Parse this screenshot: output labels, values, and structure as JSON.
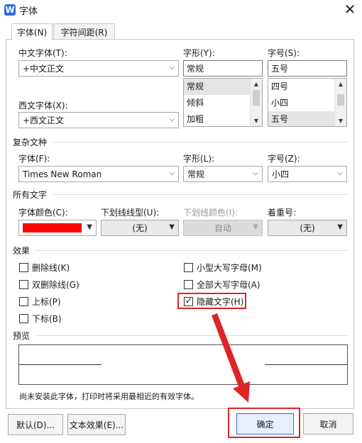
{
  "window": {
    "title": "字体",
    "app_icon": "W"
  },
  "tabs": [
    {
      "label": "字体(N)"
    },
    {
      "label": "字符间距(R)"
    }
  ],
  "chinese_font": {
    "label": "中文字体(T):",
    "value": "+中文正文"
  },
  "western_font": {
    "label": "西文字体(X):",
    "value": "+西文正文"
  },
  "style": {
    "label": "字形(Y):",
    "value": "常规",
    "options": [
      "常规",
      "倾斜",
      "加粗"
    ]
  },
  "size": {
    "label": "字号(S):",
    "value": "五号",
    "options": [
      "四号",
      "小四",
      "五号"
    ]
  },
  "complex": {
    "section": "复杂文种",
    "font_label": "字体(F):",
    "font_value": "Times New Roman",
    "style_label": "字形(L):",
    "style_value": "常规",
    "size_label": "字号(Z):",
    "size_value": "小四"
  },
  "all_text": {
    "section": "所有文字",
    "color_label": "字体颜色(C):",
    "color_value": "#ff0000",
    "underline_label": "下划线线型(U):",
    "underline_value": "(无)",
    "underline_color_label": "下划线颜色(I):",
    "underline_color_value": "自动",
    "emphasis_label": "着重号:",
    "emphasis_value": "(无)"
  },
  "effects": {
    "section": "效果",
    "items": [
      {
        "label": "删除线(K)",
        "checked": false
      },
      {
        "label": "双删除线(G)",
        "checked": false
      },
      {
        "label": "上标(P)",
        "checked": false
      },
      {
        "label": "下标(B)",
        "checked": false
      },
      {
        "label": "小型大写字母(M)",
        "checked": false
      },
      {
        "label": "全部大写字母(A)",
        "checked": false
      },
      {
        "label": "隐藏文字(H)",
        "checked": true
      }
    ]
  },
  "preview": {
    "section": "预览",
    "note": "尚未安装此字体，打印时将采用最相近的有效字体。"
  },
  "buttons": {
    "default": "默认(D)...",
    "text_effects": "文本效果(E)...",
    "ok": "确定",
    "cancel": "取消"
  },
  "annotation_color": "#e02424"
}
